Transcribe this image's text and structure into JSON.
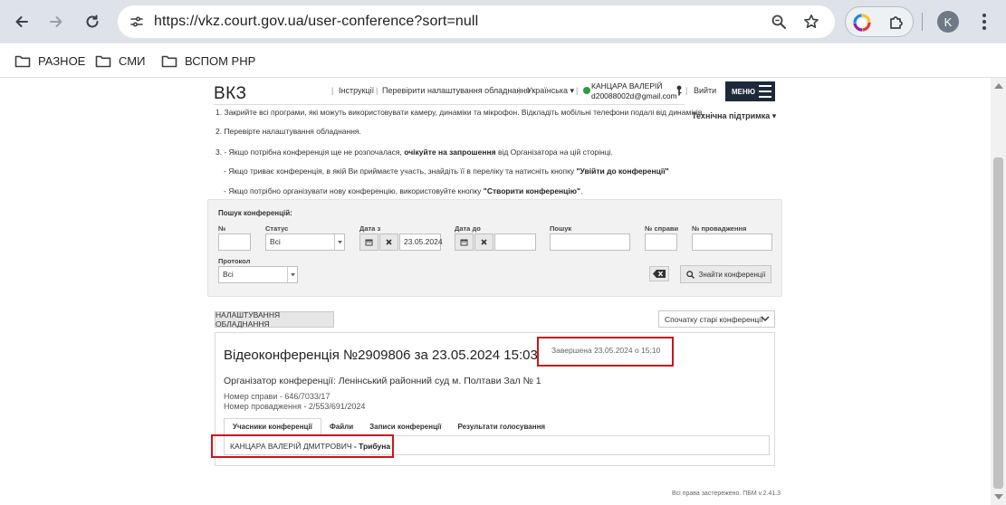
{
  "browser": {
    "url": "https://vkz.court.gov.ua/user-conference?sort=null",
    "profile_initial": "K",
    "bookmarks": [
      "РАЗНОЕ",
      "СМИ",
      "ВСПОМ РНР"
    ]
  },
  "header": {
    "logo": "ВКЗ",
    "nav": {
      "instructions": "Інструкції",
      "check_equipment": "Перевірити налаштування обладнання",
      "language": "Українська ▾"
    },
    "user": {
      "name": "КАНЦАРА ВАЛЕРІЙ",
      "email": "d20088002d@gmail.com"
    },
    "logout": "Вийти",
    "menu": "МЕНЮ",
    "support": "Технічна підтримка ▾"
  },
  "instructions": {
    "line1": "1. Закрийте всі програми, які можуть використовувати камеру, динаміки та мікрофон. Відкладіть мобільні телефони подалі від динаміків.",
    "line2": "2. Перевірте налаштування обладнання.",
    "line3_prefix": "3.  - Якщо потрібна конференція ще не розпочалася, ",
    "line3_bold": "очікуйте на запрошення",
    "line3_suffix": " від Організатора на цій сторінці.",
    "line4_prefix": "- Якщо триває конференція, в якій Ви приймаєте участь, знайдіть її в переліку та натисніть кнопку ",
    "line4_bold": "\"Увійти до конференції\"",
    "line5_prefix": "- Якщо потрібно організувати нову конференцію, використовуйте кнопку ",
    "line5_bold": "\"Створити конференцію\"",
    "line5_suffix": "."
  },
  "search": {
    "title": "Пошук конференцій:",
    "labels": {
      "number": "№",
      "status": "Статус",
      "date_from": "Дата з",
      "date_to": "Дата до",
      "search": "Пошук",
      "case_no": "№ справи",
      "proceeding_no": "№ провадження",
      "protocol": "Протокол"
    },
    "values": {
      "number": "",
      "status": "Всі",
      "date_from": "23.05.2024",
      "date_to": "",
      "search": "",
      "case_no": "",
      "proceeding_no": "",
      "protocol": "Всі"
    },
    "find_button": "Знайти конференції"
  },
  "settings_button": "НАЛАШТУВАННЯ ОБЛАДНАННЯ",
  "sort_option": "Спочатку старі конференції",
  "conference": {
    "title": "Відеоконференція №2909806 за 23.05.2024 15:03",
    "status": "Завершена 23.05.2024 о 15:10",
    "organizer": "Організатор конференції: Ленінський районний суд м. Полтави Зал № 1",
    "case_number": "Номер справи - 646/7033/17",
    "proceeding_number": "Номер провадження - 2/553/691/2024",
    "tabs": [
      "Учасники конференції",
      "Файли",
      "Записи конференції",
      "Результати голосування"
    ],
    "participant_name": "КАНЦАРА ВАЛЕРІЙ ДМИТРОВИЧ",
    "participant_role": " - Трибуна"
  },
  "footer": "Всі права застережено. ПБМ v.2.41.3",
  "colors": {
    "chrome_bg": "#dee3ea",
    "menu_bg": "#1e2a3b",
    "online": "#2e9e3a",
    "highlight": "#c8161c"
  }
}
